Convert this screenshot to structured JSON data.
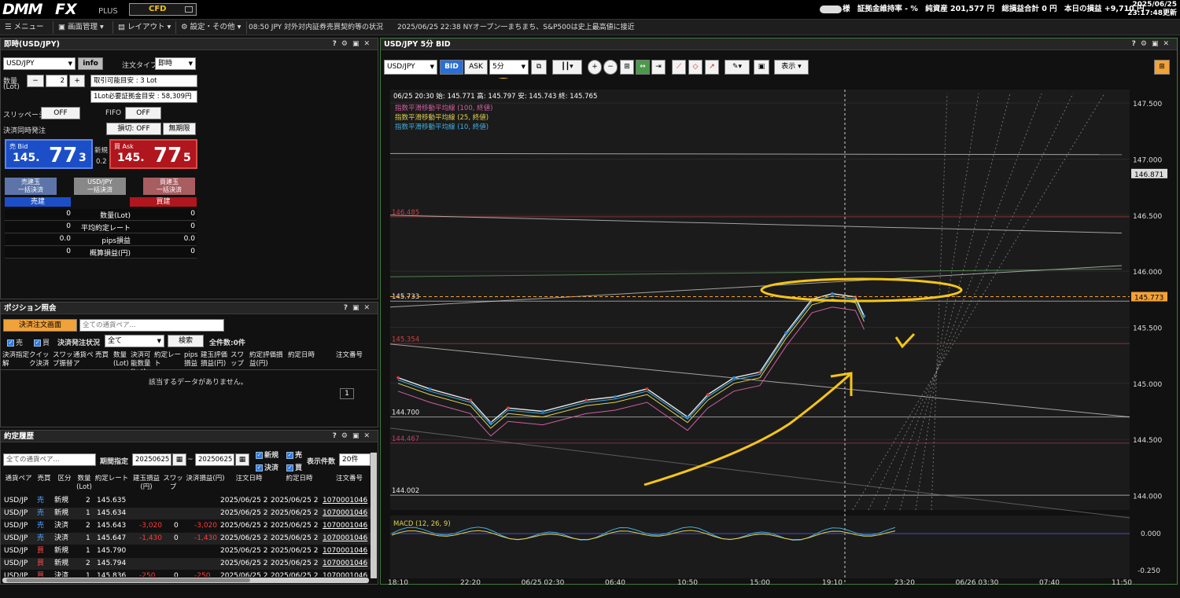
{
  "topbar": {
    "logo_a": "DMM",
    "logo_b": "FX",
    "logo_c": "PLUS",
    "cfd": "CFD",
    "acct_suffix": "様",
    "margin_rate": "証拠金維持率 - %",
    "net_assets": "純資産 201,577 円",
    "total_pl": "総損益合計 0 円",
    "today_pl": "本日の損益 +9,710 円",
    "date": "2025/06/25",
    "time": "23:17:48更新"
  },
  "menubar": {
    "menu": "メニュー",
    "screen": "画面管理",
    "layout": "レイアウト",
    "settings": "設定・その他",
    "news": "08:50 JPY 対外対内証券売買契約等の状況　　2025/06/25 22:38 NYオープン一まちまち、S&P500は史上最高値に接近"
  },
  "order": {
    "title": "即時(USD/JPY)",
    "pair": "USD/JPY",
    "info": "info",
    "order_type_label": "注文タイプ",
    "order_type": "即時",
    "qty_label": "数量",
    "qty_unit": "(Lot)",
    "minus": "−",
    "qty": "2",
    "plus": "+",
    "tradable": "取引可能目安 : 3 Lot",
    "margin_needed": "1Lot必要証拠金目安 : 58,309円",
    "slippage": "スリッページ",
    "off": "OFF",
    "fifo": "FIFO",
    "settle_label": "決済同時発注",
    "stop": "損切: OFF",
    "unlimited": "無期限",
    "bid_label": "売 Bid",
    "bid_big": "145.",
    "bid_pips": "77",
    "bid_frac": "3",
    "new_label": "新規",
    "spread": "0.2",
    "ask_label": "買 Ask",
    "ask_big": "145.",
    "ask_pips": "77",
    "ask_frac": "5",
    "sell_close_a": "売建玉",
    "sell_close_b": "一括決済",
    "pair_close_a": "USD/JPY",
    "pair_close_b": "一括決済",
    "buy_close_a": "買建玉",
    "buy_close_b": "一括決済",
    "sell_hdr": "売建",
    "buy_hdr": "買建",
    "summary": [
      {
        "label": "数量(Lot)",
        "sell": "0",
        "buy": "0"
      },
      {
        "label": "平均約定レート",
        "sell": "0",
        "buy": "0"
      },
      {
        "label": "pips損益",
        "sell": "0.0",
        "buy": "0.0"
      },
      {
        "label": "概算損益(円)",
        "sell": "0",
        "buy": "0"
      }
    ]
  },
  "positions": {
    "title": "ポジション照会",
    "settle_btn": "決済注文画面",
    "pair_ph": "全ての通貨ペア...",
    "sell": "売",
    "buy": "買",
    "status_label": "決済発注状況",
    "status": "全て",
    "search": "検索",
    "count": "全件数:0件",
    "cols": [
      "決済指定解",
      "クイック決済",
      "スワップ振替",
      "通貨ペア",
      "売買",
      "数量(Lot)",
      "決済可能数量(Lot)",
      "約定レート",
      "pips損益",
      "建玉評価損益(円)",
      "スワップ",
      "約定評価損益(円)",
      "約定日時",
      "注文番号"
    ],
    "empty": "該当するデータがありません。",
    "page": "1"
  },
  "history": {
    "title": "約定履歴",
    "pair_ph": "全ての通貨ペア...",
    "period_label": "期間指定",
    "from": "20250625",
    "to": "20250625",
    "new": "新規",
    "sell": "売",
    "settle": "決済",
    "buy": "買",
    "count_label": "表示件数",
    "count": "20件",
    "cols": [
      "通貨ペア",
      "売買",
      "区分",
      "数量(Lot)",
      "約定レート",
      "建玉損益(円)",
      "スワップ",
      "決済損益(円)",
      "注文日時",
      "約定日時",
      "注文番号"
    ],
    "rows": [
      {
        "pair": "USD/JP",
        "side": "売",
        "type": "新規",
        "qty": "2",
        "rate": "145.635",
        "pl": "",
        "swap": "",
        "spl": "",
        "ot": "2025/06/25 2",
        "ft": "2025/06/25 2",
        "no": "1070001046",
        "sc": "#4aa3ff"
      },
      {
        "pair": "USD/JP",
        "side": "売",
        "type": "新規",
        "qty": "1",
        "rate": "145.634",
        "pl": "",
        "swap": "",
        "spl": "",
        "ot": "2025/06/25 2",
        "ft": "2025/06/25 2",
        "no": "1070001046",
        "sc": "#4aa3ff"
      },
      {
        "pair": "USD/JP",
        "side": "売",
        "type": "決済",
        "qty": "2",
        "rate": "145.643",
        "pl": "-3,020",
        "swap": "0",
        "spl": "-3,020",
        "ot": "2025/06/25 2",
        "ft": "2025/06/25 2",
        "no": "1070001046",
        "sc": "#4aa3ff"
      },
      {
        "pair": "USD/JP",
        "side": "売",
        "type": "決済",
        "qty": "1",
        "rate": "145.647",
        "pl": "-1,430",
        "swap": "0",
        "spl": "-1,430",
        "ot": "2025/06/25 2",
        "ft": "2025/06/25 2",
        "no": "1070001046",
        "sc": "#4aa3ff"
      },
      {
        "pair": "USD/JP",
        "side": "買",
        "type": "新規",
        "qty": "1",
        "rate": "145.790",
        "pl": "",
        "swap": "",
        "spl": "",
        "ot": "2025/06/25 2",
        "ft": "2025/06/25 2",
        "no": "1070001046",
        "sc": "#ff4a4a"
      },
      {
        "pair": "USD/JP",
        "side": "買",
        "type": "新規",
        "qty": "2",
        "rate": "145.794",
        "pl": "",
        "swap": "",
        "spl": "",
        "ot": "2025/06/25 2",
        "ft": "2025/06/25 2",
        "no": "1070001046",
        "sc": "#ff4a4a"
      },
      {
        "pair": "USD/JP",
        "side": "買",
        "type": "決済",
        "qty": "1",
        "rate": "145.836",
        "pl": "-250",
        "swap": "0",
        "spl": "-250",
        "ot": "2025/06/25 2",
        "ft": "2025/06/25 2",
        "no": "1070001046",
        "sc": "#ff4a4a"
      }
    ]
  },
  "chart": {
    "title": "USD/JPY 5分 BID",
    "pair": "USD/JPY",
    "bid": "BID",
    "ask": "ASK",
    "timeframe": "5分",
    "display": "表示",
    "ohlc": "06/25 20:30  始: 145.771  高: 145.797  安: 145.743  終: 145.765",
    "ma100": "指数平滑移動平均線 (100, 終値)",
    "ma25": "指数平滑移動平均線 (25, 終値)",
    "ma10": "指数平滑移動平均線 (10, 終値)",
    "macd": "MACD (12, 26, 9)",
    "crosshair_time": "06/25 20:30",
    "line_labels": [
      {
        "text": "146.485",
        "price": 146.485,
        "color": "#d04040"
      },
      {
        "text": "145.733",
        "price": 145.733,
        "color": "#e8e8e8"
      },
      {
        "text": "145.354",
        "price": 145.354,
        "color": "#d04040"
      },
      {
        "text": "144.700",
        "price": 144.7,
        "color": "#e8e8e8"
      },
      {
        "text": "144.467",
        "price": 144.467,
        "color": "#c04070"
      },
      {
        "text": "144.002",
        "price": 144.002,
        "color": "#e8e8e8"
      }
    ],
    "price_tag": "146.871",
    "current_tag": "145.773",
    "macd_ticks": [
      "0.000",
      "-0.250"
    ]
  },
  "chart_data": {
    "type": "line",
    "title": "USD/JPY 5分 BID",
    "x_ticks": [
      "18:10",
      "22:20",
      "06/25 02:30",
      "06:40",
      "10:50",
      "15:00",
      "19:10",
      "23:20",
      "06/26 03:30",
      "07:40",
      "11:50"
    ],
    "y_ticks": [
      "147.500",
      "147.000",
      "146.500",
      "146.000",
      "145.500",
      "145.000",
      "144.500",
      "144.000"
    ],
    "ylim": [
      143.87,
      147.62
    ],
    "series": [
      {
        "name": "BID",
        "x": [
          "18:10",
          "20:00",
          "22:20",
          "23:30",
          "00:30",
          "02:30",
          "05:00",
          "06:40",
          "08:30",
          "10:50",
          "12:00",
          "13:30",
          "15:00",
          "16:30",
          "18:00",
          "19:10",
          "20:30",
          "21:00"
        ],
        "values": [
          145.05,
          144.95,
          144.85,
          144.65,
          144.78,
          144.75,
          144.85,
          144.88,
          144.95,
          144.7,
          144.9,
          145.05,
          145.1,
          145.45,
          145.75,
          145.8,
          145.77,
          145.6
        ]
      }
    ]
  }
}
